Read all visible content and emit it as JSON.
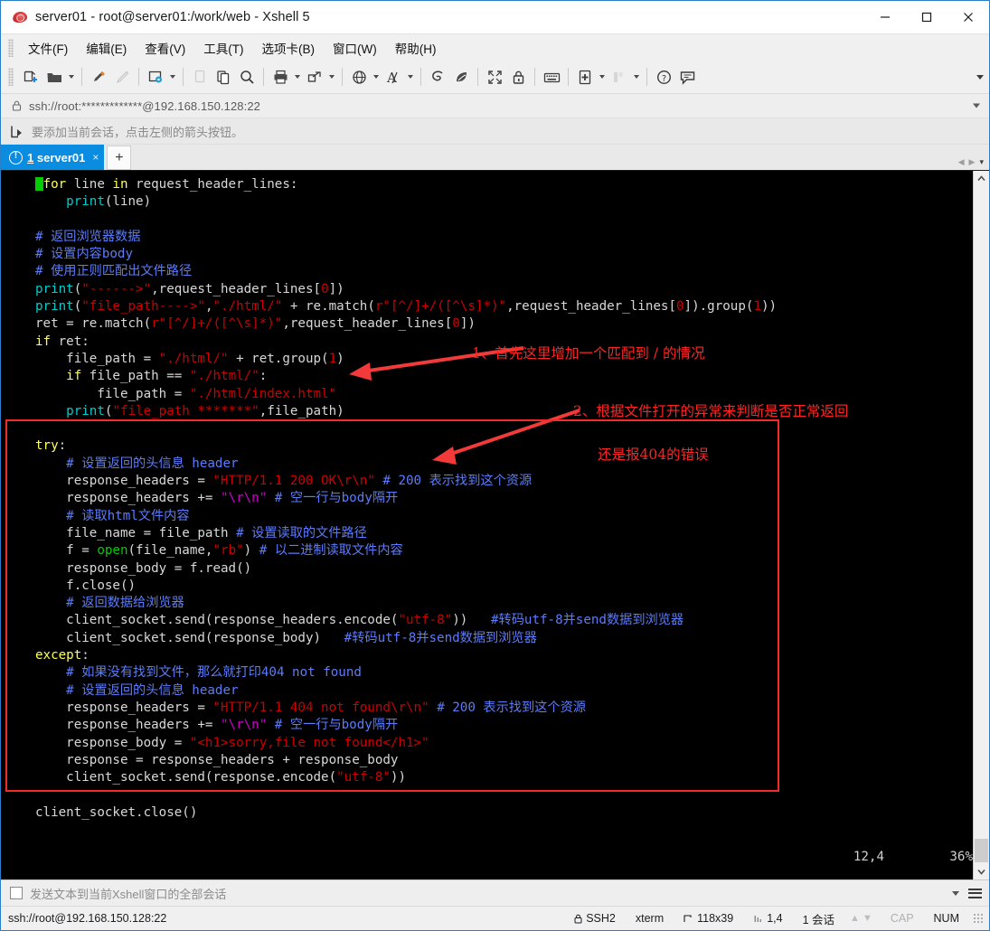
{
  "window": {
    "title": "server01 - root@server01:/work/web - Xshell 5",
    "app_icon": "xshell-shell-icon",
    "controls": {
      "minimize": "minimize-icon",
      "maximize": "maximize-icon",
      "close": "close-icon"
    }
  },
  "menubar": [
    {
      "label": "文件(F)",
      "name": "menu-file"
    },
    {
      "label": "编辑(E)",
      "name": "menu-edit"
    },
    {
      "label": "查看(V)",
      "name": "menu-view"
    },
    {
      "label": "工具(T)",
      "name": "menu-tools"
    },
    {
      "label": "选项卡(B)",
      "name": "menu-tabs"
    },
    {
      "label": "窗口(W)",
      "name": "menu-window"
    },
    {
      "label": "帮助(H)",
      "name": "menu-help"
    }
  ],
  "toolbar": {
    "icons": [
      "new-session-icon",
      "open-folder-icon",
      "highlight-pen-icon",
      "pencil-icon",
      "session-properties-icon",
      "copy-page-icon",
      "paste-icon",
      "find-icon",
      "print-icon",
      "transfer-file-icon",
      "globe-icon",
      "font-icon",
      "xftp-icon",
      "xagent-icon",
      "fullscreen-icon",
      "lock-icon",
      "keyboard-icon",
      "add-note-icon",
      "layout-icon",
      "help-icon",
      "chat-icon"
    ],
    "overflow": "toolbar-overflow-icon"
  },
  "address": {
    "lock_icon": "lock-icon",
    "value": "ssh://root:*************@192.168.150.128:22",
    "dropdown": "address-dropdown-icon"
  },
  "hint": {
    "icon": "add-session-arrow-icon",
    "text": "要添加当前会话，点击左侧的箭头按钮。"
  },
  "tabs": {
    "items": [
      {
        "warn_icon": "warning-icon",
        "number": "1",
        "name": "server01",
        "close": "×"
      }
    ],
    "add_label": "+",
    "nav_prev": "◀",
    "nav_next": "▶",
    "nav_dropdown": "▾"
  },
  "terminal": {
    "cursor_pos": "12,4",
    "scroll_pct": "36%",
    "scroll_up_icon": "scroll-up-icon",
    "scroll_down_icon": "scroll-down-icon",
    "lines": [
      [
        {
          "t": "cursor"
        },
        {
          "t": "kw",
          "v": "for"
        },
        {
          "t": "pl",
          "v": " line "
        },
        {
          "t": "kw",
          "v": "in"
        },
        {
          "t": "pl",
          "v": " request_header_lines:"
        }
      ],
      [
        {
          "t": "pl",
          "v": "    "
        },
        {
          "t": "fn",
          "v": "print"
        },
        {
          "t": "pl",
          "v": "(line)"
        }
      ],
      [],
      [
        {
          "t": "cmt",
          "v": "# 返回浏览器数据"
        }
      ],
      [
        {
          "t": "cmt",
          "v": "# 设置内容body"
        }
      ],
      [
        {
          "t": "cmt",
          "v": "# 使用正则匹配出文件路径"
        }
      ],
      [
        {
          "t": "fn",
          "v": "print"
        },
        {
          "t": "pl",
          "v": "("
        },
        {
          "t": "str",
          "v": "\"------>\""
        },
        {
          "t": "pl",
          "v": ",request_header_lines["
        },
        {
          "t": "num",
          "v": "0"
        },
        {
          "t": "pl",
          "v": "])"
        }
      ],
      [
        {
          "t": "fn",
          "v": "print"
        },
        {
          "t": "pl",
          "v": "("
        },
        {
          "t": "str",
          "v": "\"file_path---->\""
        },
        {
          "t": "pl",
          "v": ","
        },
        {
          "t": "str",
          "v": "\"./html/\""
        },
        {
          "t": "pl",
          "v": " + re.match("
        },
        {
          "t": "str",
          "v": "r\"[^/]+/([^\\s]*)\""
        },
        {
          "t": "pl",
          "v": ",request_header_lines["
        },
        {
          "t": "num",
          "v": "0"
        },
        {
          "t": "pl",
          "v": "]).group("
        },
        {
          "t": "num",
          "v": "1"
        },
        {
          "t": "pl",
          "v": "))"
        }
      ],
      [
        {
          "t": "pl",
          "v": "ret = re.match("
        },
        {
          "t": "str",
          "v": "r\"[^/]+/([^\\s]*)\""
        },
        {
          "t": "pl",
          "v": ",request_header_lines["
        },
        {
          "t": "num",
          "v": "0"
        },
        {
          "t": "pl",
          "v": "])"
        }
      ],
      [
        {
          "t": "kw",
          "v": "if"
        },
        {
          "t": "pl",
          "v": " ret:"
        }
      ],
      [
        {
          "t": "pl",
          "v": "    file_path = "
        },
        {
          "t": "str",
          "v": "\"./html/\""
        },
        {
          "t": "pl",
          "v": " + ret.group("
        },
        {
          "t": "num",
          "v": "1"
        },
        {
          "t": "pl",
          "v": ")"
        }
      ],
      [
        {
          "t": "pl",
          "v": "    "
        },
        {
          "t": "kw",
          "v": "if"
        },
        {
          "t": "pl",
          "v": " file_path == "
        },
        {
          "t": "str",
          "v": "\"./html/\""
        },
        {
          "t": "pl",
          "v": ":"
        }
      ],
      [
        {
          "t": "pl",
          "v": "        file_path = "
        },
        {
          "t": "str",
          "v": "\"./html/index.html\""
        }
      ],
      [
        {
          "t": "pl",
          "v": "    "
        },
        {
          "t": "fn",
          "v": "print"
        },
        {
          "t": "pl",
          "v": "("
        },
        {
          "t": "str",
          "v": "\"file_path *******\""
        },
        {
          "t": "pl",
          "v": ",file_path)"
        }
      ],
      [],
      [
        {
          "t": "kw",
          "v": "try"
        },
        {
          "t": "pl",
          "v": ":"
        }
      ],
      [
        {
          "t": "pl",
          "v": "    "
        },
        {
          "t": "cmt",
          "v": "# 设置返回的头信息 header"
        }
      ],
      [
        {
          "t": "pl",
          "v": "    response_headers = "
        },
        {
          "t": "str",
          "v": "\"HTTP/1.1 200 OK\\r\\n\""
        },
        {
          "t": "pl",
          "v": " "
        },
        {
          "t": "cmt",
          "v": "# 200 表示找到这个资源"
        }
      ],
      [
        {
          "t": "pl",
          "v": "    response_headers += "
        },
        {
          "t": "esc",
          "v": "\"\\r\\n\""
        },
        {
          "t": "pl",
          "v": " "
        },
        {
          "t": "cmt",
          "v": "# 空一行与body隔开"
        }
      ],
      [
        {
          "t": "pl",
          "v": "    "
        },
        {
          "t": "cmt",
          "v": "# 读取html文件内容"
        }
      ],
      [
        {
          "t": "pl",
          "v": "    file_name = file_path "
        },
        {
          "t": "cmt",
          "v": "# 设置读取的文件路径"
        }
      ],
      [
        {
          "t": "pl",
          "v": "    f = "
        },
        {
          "t": "def",
          "v": "open"
        },
        {
          "t": "pl",
          "v": "(file_name,"
        },
        {
          "t": "str",
          "v": "\"rb\""
        },
        {
          "t": "pl",
          "v": ") "
        },
        {
          "t": "cmt",
          "v": "# 以二进制读取文件内容"
        }
      ],
      [
        {
          "t": "pl",
          "v": "    response_body = f.read()"
        }
      ],
      [
        {
          "t": "pl",
          "v": "    f.close()"
        }
      ],
      [
        {
          "t": "pl",
          "v": "    "
        },
        {
          "t": "cmt",
          "v": "# 返回数据给浏览器"
        }
      ],
      [
        {
          "t": "pl",
          "v": "    client_socket.send(response_headers.encode("
        },
        {
          "t": "str",
          "v": "\"utf-8\""
        },
        {
          "t": "pl",
          "v": "))   "
        },
        {
          "t": "cmt",
          "v": "#转码utf-8并send数据到浏览器"
        }
      ],
      [
        {
          "t": "pl",
          "v": "    client_socket.send(response_body)   "
        },
        {
          "t": "cmt",
          "v": "#转码utf-8并send数据到浏览器"
        }
      ],
      [
        {
          "t": "kw",
          "v": "except"
        },
        {
          "t": "pl",
          "v": ":"
        }
      ],
      [
        {
          "t": "pl",
          "v": "    "
        },
        {
          "t": "cmt",
          "v": "# 如果没有找到文件，那么就打印404 not found"
        }
      ],
      [
        {
          "t": "pl",
          "v": "    "
        },
        {
          "t": "cmt",
          "v": "# 设置返回的头信息 header"
        }
      ],
      [
        {
          "t": "pl",
          "v": "    response_headers = "
        },
        {
          "t": "str",
          "v": "\"HTTP/1.1 404 not found\\r\\n\""
        },
        {
          "t": "pl",
          "v": " "
        },
        {
          "t": "cmt",
          "v": "# 200 表示找到这个资源"
        }
      ],
      [
        {
          "t": "pl",
          "v": "    response_headers += "
        },
        {
          "t": "esc",
          "v": "\"\\r\\n\""
        },
        {
          "t": "pl",
          "v": " "
        },
        {
          "t": "cmt",
          "v": "# 空一行与body隔开"
        }
      ],
      [
        {
          "t": "pl",
          "v": "    response_body = "
        },
        {
          "t": "str",
          "v": "\"<h1>sorry,file not found</h1>\""
        }
      ],
      [
        {
          "t": "pl",
          "v": "    response = response_headers + response_body"
        }
      ],
      [
        {
          "t": "pl",
          "v": "    client_socket.send(response.encode("
        },
        {
          "t": "str",
          "v": "\"utf-8\""
        },
        {
          "t": "pl",
          "v": "))"
        }
      ],
      [],
      [
        {
          "t": "pl",
          "v": "client_socket.close()"
        }
      ]
    ]
  },
  "annotations": {
    "color": "#ff2424",
    "note_1": "1、首先这里增加一个匹配到 / 的情况",
    "note_2": "2、根据文件打开的异常来判断是否正常返回",
    "note_3": "还是报404的错误"
  },
  "sendbar": {
    "checkbox": "send-to-all-checkbox",
    "text": "发送文本到当前Xshell窗口的全部会话",
    "dropdown": "sendbar-dropdown-icon",
    "menu": "sendbar-menu-icon"
  },
  "statusbar": {
    "connection": "ssh://root@192.168.150.128:22",
    "protocol_icon": "lock-icon",
    "protocol": "SSH2",
    "terminal_type": "xterm",
    "size_icon": "terminal-size-icon",
    "size": "118x39",
    "cursor_icon": "cursor-position-icon",
    "cursor": "1,4",
    "sessions": "1 会话",
    "arrow_up": "▲",
    "arrow_down": "▼",
    "caps": "CAP",
    "num": "NUM"
  }
}
